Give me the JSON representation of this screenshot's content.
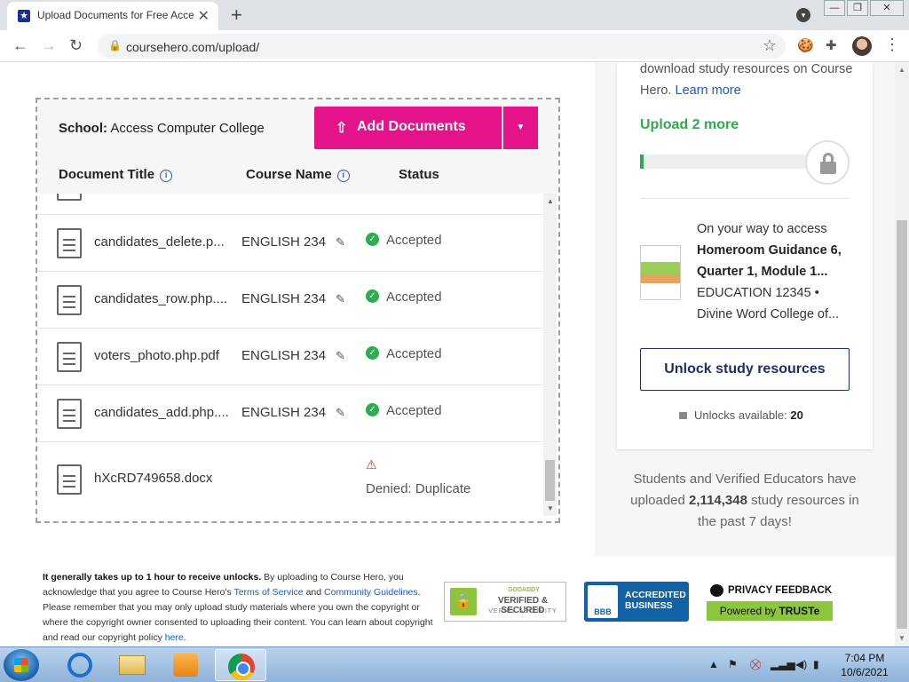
{
  "browser": {
    "tab_title": "Upload Documents for Free Acce",
    "url": "coursehero.com/upload/",
    "new_tab": "+",
    "close_tab": "✕"
  },
  "upload": {
    "school_label": "School:",
    "school_name": "Access Computer College",
    "add_button": "Add Documents",
    "columns": {
      "title": "Document Title",
      "course": "Course Name",
      "status": "Status"
    },
    "rows": [
      {
        "filename": "candidates_delete.p...",
        "course": "ENGLISH 234",
        "status": "Accepted"
      },
      {
        "filename": "candidates_row.php....",
        "course": "ENGLISH 234",
        "status": "Accepted"
      },
      {
        "filename": "voters_photo.php.pdf",
        "course": "ENGLISH 234",
        "status": "Accepted"
      },
      {
        "filename": "candidates_add.php....",
        "course": "ENGLISH 234",
        "status": "Accepted"
      },
      {
        "filename": "hXcRD749658.docx",
        "course": "",
        "status": "Denied: Duplicate"
      }
    ]
  },
  "sidebar": {
    "intro_text": "download study resources on Course Hero.",
    "learn_more": "Learn more",
    "upload_more": "Upload 2 more",
    "progress_fraction": 0.02,
    "access_intro": "On your way to access",
    "doc_title": "Homeroom Guidance 6, Quarter 1, Module 1...",
    "doc_course": "EDUCATION 12345 •",
    "doc_school": "Divine Word College of...",
    "unlock_button": "Unlock study resources",
    "unlocks_label": "Unlocks available:",
    "unlocks_count": "20",
    "stats_pre": "Students and Verified Educators have uploaded",
    "stats_count": "2,114,348",
    "stats_post": "study resources in the past 7 days!"
  },
  "footer": {
    "legal_bold": "It generally takes up to 1 hour to receive unlocks.",
    "legal_1": "By uploading to Course Hero, you acknowledge that you agree to Course Hero's",
    "tos": "Terms of Service",
    "and": "and",
    "guidelines": "Community Guidelines",
    "legal_2": ". Please remember that you may only upload study materials where you own the copyright or where the copyright owner consented to uploading their content. You can learn about copyright and read our copyright policy",
    "here": "here",
    "period": ".",
    "godaddy_top": "GODADDY",
    "godaddy_main": "VERIFIED & SECURED",
    "godaddy_sub": "VERIFY SECURITY",
    "bbb_logo": "BBB",
    "bbb_text": "ACCREDITED BUSINESS",
    "truste_top": "PRIVACY FEEDBACK",
    "truste_pre": "Powered by",
    "truste_brand": "TRUSTe"
  },
  "taskbar": {
    "time": "7:04 PM",
    "date": "10/6/2021"
  },
  "colors": {
    "accent_magenta": "#e5138a",
    "success_green": "#2eab4f",
    "navy": "#1c2f6b",
    "link_blue": "#1a5bc4"
  }
}
